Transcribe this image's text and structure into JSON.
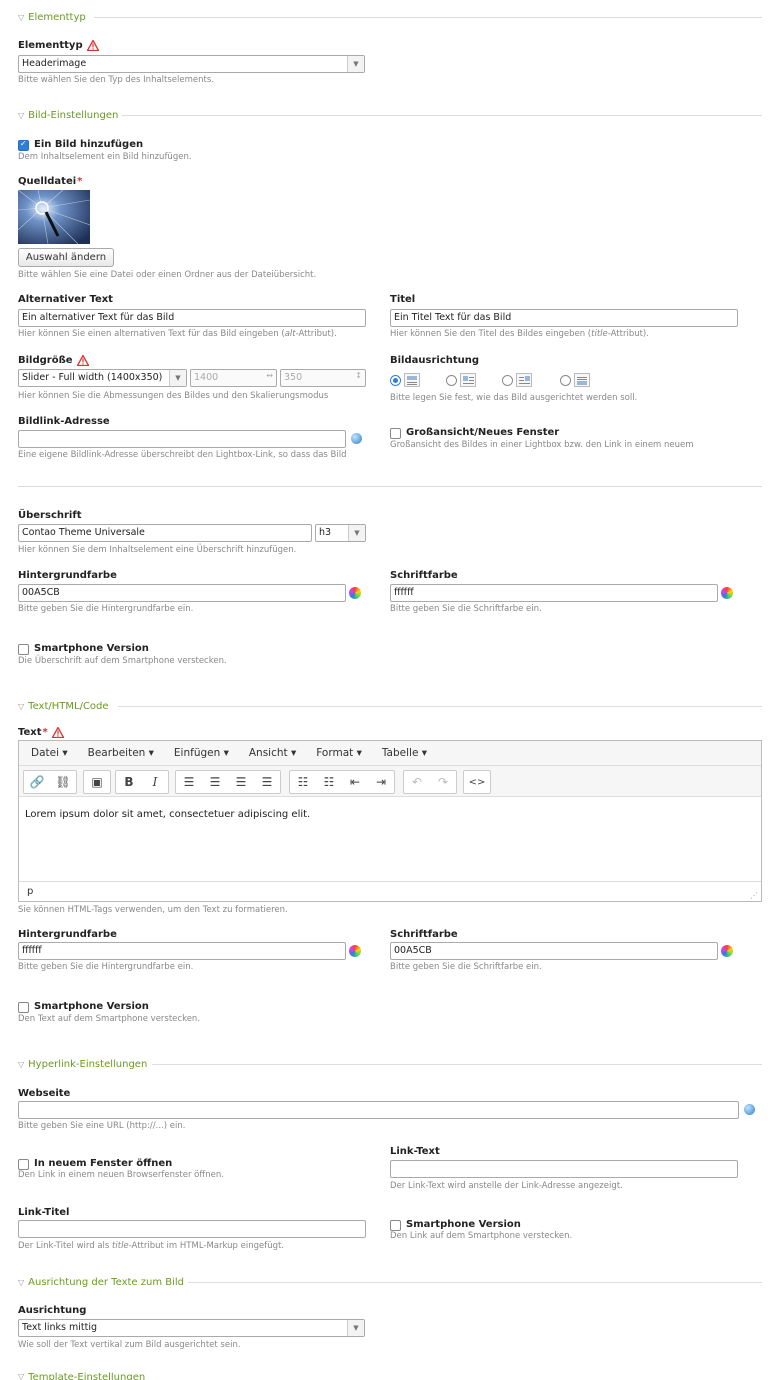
{
  "sections": {
    "elementtyp": "Elementtyp",
    "bild": "Bild-Einstellungen",
    "text": "Text/HTML/Code",
    "hyperlink": "Hyperlink-Einstellungen",
    "ausrichtung": "Ausrichtung der Texte zum Bild",
    "template": "Template-Einstellungen"
  },
  "elementtyp": {
    "label": "Elementtyp",
    "value": "Headerimage",
    "hint": "Bitte wählen Sie den Typ des Inhaltselements."
  },
  "add_image": {
    "label": "Ein Bild hinzufügen",
    "checked": true,
    "hint": "Dem Inhaltselement ein Bild hinzufügen."
  },
  "quelldatei": {
    "label": "Quelldatei",
    "required": "*",
    "button": "Auswahl ändern",
    "hint": "Bitte wählen Sie eine Datei oder einen Ordner aus der Dateiübersicht."
  },
  "alt": {
    "label": "Alternativer Text",
    "value": "Ein alternativer Text für das Bild",
    "hint": "Hier können Sie einen alternativen Text für das Bild eingeben (alt-Attribut)."
  },
  "titel": {
    "label": "Titel",
    "value": "Ein Titel Text für das Bild",
    "hint": "Hier können Sie den Titel des Bildes eingeben (title-Attribut)."
  },
  "bildgroesse": {
    "label": "Bildgröße",
    "value": "Slider - Full width (1400x350)",
    "width": "1400",
    "height": "350",
    "hint": "Hier können Sie die Abmessungen des Bildes und den Skalierungsmodus"
  },
  "bildausrichtung": {
    "label": "Bildausrichtung",
    "selected_index": 0,
    "hint": "Bitte legen Sie fest, wie das Bild ausgerichtet werden soll."
  },
  "bildlink": {
    "label": "Bildlink-Adresse",
    "value": "",
    "hint": "Eine eigene Bildlink-Adresse überschreibt den Lightbox-Link, so dass das Bild"
  },
  "grossansicht": {
    "label": "Großansicht/Neues Fenster",
    "checked": false,
    "hint": "Großansicht des Bildes in einer Lightbox bzw. den Link in einem neuem"
  },
  "ueberschrift": {
    "label": "Überschrift",
    "value": "Contao Theme Universale",
    "level": "h3",
    "hint": "Hier können Sie dem Inhaltselement eine Überschrift hinzufügen."
  },
  "headline_bg": {
    "label": "Hintergrundfarbe",
    "value": "00A5CB",
    "hint": "Bitte geben Sie die Hintergrundfarbe ein."
  },
  "headline_fg": {
    "label": "Schriftfarbe",
    "value": "ffffff",
    "hint": "Bitte geben Sie die Schriftfarbe ein."
  },
  "headline_smartphone": {
    "label": "Smartphone Version",
    "checked": false,
    "hint": "Die Überschrift auf dem Smartphone verstecken."
  },
  "text": {
    "label": "Text",
    "required": "*",
    "menu": [
      "Datei ▾",
      "Bearbeiten ▾",
      "Einfügen ▾",
      "Ansicht ▾",
      "Format ▾",
      "Tabelle ▾"
    ],
    "content": "Lorem ipsum dolor sit amet, consectetuer adipiscing elit.",
    "status": "p",
    "hint": "Sie können HTML-Tags verwenden, um den Text zu formatieren."
  },
  "text_bg": {
    "label": "Hintergrundfarbe",
    "value": "ffffff",
    "hint": "Bitte geben Sie die Hintergrundfarbe ein."
  },
  "text_fg": {
    "label": "Schriftfarbe",
    "value": "00A5CB",
    "hint": "Bitte geben Sie die Schriftfarbe ein."
  },
  "text_smartphone": {
    "label": "Smartphone Version",
    "checked": false,
    "hint": "Den Text auf dem Smartphone verstecken."
  },
  "webseite": {
    "label": "Webseite",
    "value": "",
    "hint": "Bitte geben Sie eine URL (http://...) ein."
  },
  "neues_fenster": {
    "label": "In neuem Fenster öffnen",
    "checked": false,
    "hint": "Den Link in einem neuen Browserfenster öffnen."
  },
  "linktext": {
    "label": "Link-Text",
    "value": "",
    "hint": "Der Link-Text wird anstelle der Link-Adresse angezeigt."
  },
  "linktitel": {
    "label": "Link-Titel",
    "value": "",
    "hint": "Der Link-Titel wird als title-Attribut im HTML-Markup eingefügt."
  },
  "link_smartphone": {
    "label": "Smartphone Version",
    "checked": false,
    "hint": "Den Link auf dem Smartphone verstecken."
  },
  "ausrichtung": {
    "label": "Ausrichtung",
    "value": "Text links mittig",
    "hint": "Wie soll der Text vertikal zum Bild ausgerichtet sein."
  },
  "colors": {
    "accent": "#6a9a1f",
    "checkbox": "#2f7ed8",
    "required": "#cc3333"
  }
}
